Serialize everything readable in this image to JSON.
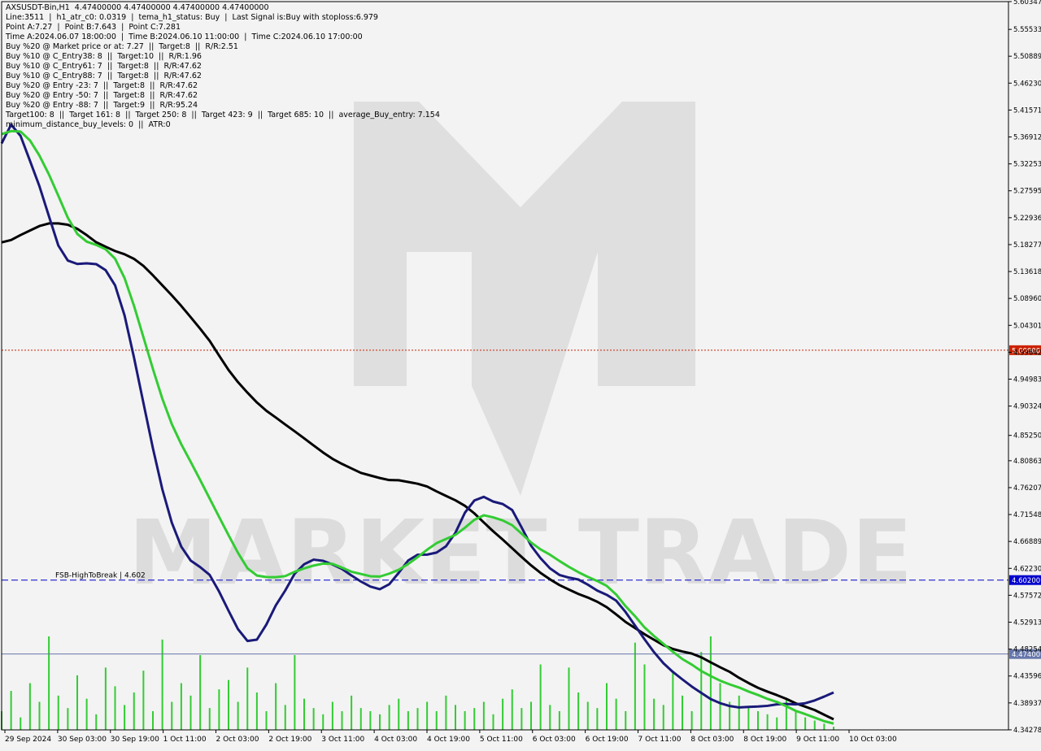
{
  "header": {
    "lines": [
      "AXSUSDT-Bin,H1  4.47400000 4.47400000 4.47400000 4.47400000",
      "Line:3511  |  h1_atr_c0: 0.0319  |  tema_h1_status: Buy  |  Last Signal is:Buy with stoploss:6.979",
      "Point A:7.27  |  Point B:7.643  |  Point C:7.281",
      "Time A:2024.06.07 18:00:00  |  Time B:2024.06.10 11:00:00  |  Time C:2024.06.10 17:00:00",
      "Buy %20 @ Market price or at: 7.27  ||  Target:8  ||  R/R:2.51",
      "Buy %10 @ C_Entry38: 8  ||  Target:10  ||  R/R:1.96",
      "Buy %10 @ C_Entry61: 7  ||  Target:8  ||  R/R:47.62",
      "Buy %10 @ C_Entry88: 7  ||  Target:8  ||  R/R:47.62",
      "Buy %20 @ Entry -23: 7  ||  Target:8  ||  R/R:47.62",
      "Buy %20 @ Entry -50: 7  ||  Target:8  ||  R/R:47.62",
      "Buy %20 @ Entry -88: 7  ||  Target:9  ||  R/R:95.24",
      "Target100: 8  ||  Target 161: 8  ||  Target 250: 8  ||  Target 423: 9  ||  Target 685: 10  ||  average_Buy_entry: 7.154",
      "minimum_distance_buy_levels: 0  ||  ATR:0"
    ]
  },
  "watermark": {
    "text": "MARKET TRADE"
  },
  "chart_data": {
    "type": "line",
    "symbol": "AXSUSDT-Bin",
    "timeframe": "H1",
    "ylim": [
      4.3427,
      5.6034
    ],
    "y_ticks": [
      "5.60347",
      "5.55533",
      "5.50889",
      "5.46230",
      "5.41571",
      "5.36912",
      "5.32253",
      "5.27595",
      "5.22936",
      "5.18277",
      "5.13618",
      "5.08960",
      "5.04301",
      "4.99642",
      "4.94983",
      "4.90324",
      "4.85250",
      "4.80863",
      "4.76207",
      "4.71548",
      "4.66889",
      "4.62230",
      "4.57572",
      "4.52913",
      "4.48254",
      "4.43596",
      "4.38937",
      "4.34278"
    ],
    "x_ticks": [
      "29 Sep 2024",
      "30 Sep 03:00",
      "30 Sep 19:00",
      "1 Oct 11:00",
      "2 Oct 03:00",
      "2 Oct 19:00",
      "3 Oct 11:00",
      "4 Oct 03:00",
      "4 Oct 19:00",
      "5 Oct 11:00",
      "6 Oct 03:00",
      "6 Oct 19:00",
      "7 Oct 11:00",
      "8 Oct 03:00",
      "8 Oct 19:00",
      "9 Oct 11:00",
      "10 Oct 03:00"
    ],
    "levels": [
      {
        "label": "5.00000",
        "value": 5.0,
        "color": "#cc2200",
        "style": "dotted"
      },
      {
        "label": "4.60200",
        "value": 4.602,
        "color": "#0000cc",
        "style": "dashed",
        "name": "FSB-HighToBreak | 4.602"
      },
      {
        "label": "4.47400",
        "value": 4.474,
        "color": "#6677aa",
        "style": "solid"
      }
    ],
    "series": [
      {
        "color": "#000000",
        "x": [
          0,
          3,
          6,
          9,
          12,
          15,
          18,
          21,
          24,
          27,
          30,
          33,
          36,
          39,
          42,
          45,
          48,
          51,
          54,
          57,
          60,
          63,
          66,
          69,
          72,
          75,
          78,
          81,
          84,
          87,
          90,
          93,
          96,
          99,
          102,
          105,
          108,
          111,
          114,
          117,
          120,
          123,
          126,
          129,
          132,
          135,
          138,
          141,
          144,
          147,
          150,
          153,
          156,
          159,
          162,
          165,
          168,
          171,
          174,
          177,
          180,
          183,
          186,
          189,
          192,
          195,
          198,
          201,
          204,
          207,
          210,
          213,
          216,
          219,
          222,
          225,
          228,
          231,
          234,
          237,
          240,
          243,
          246,
          249,
          252,
          255,
          258,
          261,
          264
        ],
        "y": [
          5.1866,
          5.1907,
          5.1993,
          5.2071,
          5.2149,
          5.2194,
          5.2194,
          5.2172,
          5.2101,
          5.1992,
          5.1869,
          5.1791,
          5.1716,
          5.1661,
          5.1581,
          5.1458,
          5.1296,
          5.1123,
          5.0949,
          5.0766,
          5.057,
          5.0371,
          5.0162,
          4.9908,
          4.9657,
          4.9447,
          4.9265,
          4.9095,
          4.8951,
          4.8834,
          4.8713,
          4.8595,
          4.8474,
          4.8351,
          4.8229,
          4.8119,
          4.8031,
          4.7953,
          4.7876,
          4.7831,
          4.7787,
          4.7751,
          4.7748,
          4.7719,
          4.7688,
          4.764,
          4.7556,
          4.7477,
          4.7401,
          4.7306,
          4.7175,
          4.7017,
          4.6864,
          4.6721,
          4.6571,
          4.642,
          4.6275,
          4.6145,
          4.6033,
          4.5934,
          4.5856,
          4.578,
          4.5718,
          4.5645,
          4.5551,
          4.5426,
          4.5295,
          4.5189,
          4.5083,
          4.4987,
          4.4893,
          4.4827,
          4.4784,
          4.4748,
          4.4683,
          4.4595,
          4.4511,
          4.4432,
          4.4328,
          4.4238,
          4.4155,
          4.4089,
          4.4029,
          4.3964,
          4.3886,
          4.3829,
          4.377,
          4.3689,
          4.361
        ]
      },
      {
        "color": "#1a1a7a",
        "x": [
          0,
          3,
          6,
          9,
          12,
          15,
          18,
          21,
          24,
          27,
          30,
          33,
          36,
          39,
          42,
          45,
          48,
          51,
          54,
          57,
          60,
          63,
          66,
          69,
          72,
          75,
          78,
          81,
          84,
          87,
          90,
          93,
          96,
          99,
          102,
          105,
          108,
          111,
          114,
          117,
          120,
          123,
          126,
          129,
          132,
          135,
          138,
          141,
          144,
          147,
          150,
          153,
          156,
          159,
          162,
          165,
          168,
          171,
          174,
          177,
          180,
          183,
          186,
          189,
          192,
          195,
          198,
          201,
          204,
          207,
          210,
          213,
          216,
          219,
          222,
          225,
          228,
          231,
          234,
          237,
          240,
          243,
          246,
          249,
          252,
          255,
          258,
          261,
          264
        ],
        "y": [
          5.358,
          5.3904,
          5.3711,
          5.3277,
          5.2838,
          5.2321,
          5.1811,
          5.1552,
          5.1493,
          5.1503,
          5.149,
          5.1385,
          5.1123,
          5.0603,
          4.9873,
          4.9085,
          4.8304,
          4.759,
          4.7014,
          4.6599,
          4.6357,
          4.6245,
          4.611,
          4.5822,
          4.549,
          4.517,
          4.4966,
          4.4989,
          4.525,
          4.5582,
          4.584,
          4.6132,
          4.6295,
          4.6374,
          4.6354,
          4.629,
          4.6213,
          4.61,
          4.5995,
          4.5908,
          4.5862,
          4.5948,
          4.6146,
          4.6359,
          4.6459,
          4.6461,
          4.6496,
          4.6605,
          4.684,
          4.7186,
          4.7398,
          4.7461,
          4.7379,
          4.7337,
          4.7233,
          4.6931,
          4.6616,
          4.6399,
          4.6223,
          4.6109,
          4.6063,
          4.603,
          4.5941,
          4.5838,
          4.5765,
          4.5664,
          4.5466,
          4.5231,
          4.4996,
          4.4773,
          4.4581,
          4.443,
          4.4301,
          4.4177,
          4.4068,
          4.396,
          4.3889,
          4.384,
          4.3815,
          4.3825,
          4.3832,
          4.3843,
          4.3868,
          4.3875,
          4.3869,
          4.3888,
          4.3937,
          4.4003,
          4.4075
        ]
      },
      {
        "color": "#33cc33",
        "x": [
          0,
          3,
          6,
          9,
          12,
          15,
          18,
          21,
          24,
          27,
          30,
          33,
          36,
          39,
          42,
          45,
          48,
          51,
          54,
          57,
          60,
          63,
          66,
          69,
          72,
          75,
          78,
          81,
          84,
          87,
          90,
          93,
          96,
          99,
          102,
          105,
          108,
          111,
          114,
          117,
          120,
          123,
          126,
          129,
          132,
          135,
          138,
          141,
          144,
          147,
          150,
          153,
          156,
          159,
          162,
          165,
          168,
          171,
          174,
          177,
          180,
          183,
          186,
          189,
          192,
          195,
          198,
          201,
          204,
          207,
          210,
          213,
          216,
          219,
          222,
          225,
          228,
          231,
          234,
          237,
          240,
          243,
          246,
          249,
          252,
          255,
          258,
          261,
          264
        ],
        "y": [
          5.3739,
          5.3793,
          5.3785,
          5.3631,
          5.3369,
          5.3043,
          5.2673,
          5.2293,
          5.2013,
          5.1879,
          5.1823,
          5.1747,
          5.1583,
          5.1249,
          5.0769,
          5.0224,
          4.9676,
          4.9159,
          4.872,
          4.8372,
          4.8066,
          4.7752,
          4.7433,
          4.7115,
          4.6798,
          4.6492,
          4.6225,
          4.6099,
          4.6072,
          4.6071,
          4.6089,
          4.6163,
          4.6223,
          4.6271,
          4.6305,
          4.63,
          4.6235,
          4.6165,
          4.6126,
          4.6087,
          4.6081,
          4.6132,
          4.6198,
          4.6298,
          4.6418,
          4.6545,
          4.6659,
          4.6731,
          4.6803,
          4.6926,
          4.7064,
          4.7142,
          4.7106,
          4.7053,
          4.697,
          4.6823,
          4.6671,
          4.6552,
          4.646,
          4.6351,
          4.6249,
          4.6157,
          4.6076,
          4.6004,
          4.592,
          4.577,
          4.5567,
          4.5394,
          4.5201,
          4.5052,
          4.4917,
          4.4778,
          4.4653,
          4.4557,
          4.4446,
          4.4358,
          4.4279,
          4.4215,
          4.416,
          4.4091,
          4.4031,
          4.3964,
          4.391,
          4.3837,
          4.3756,
          4.37,
          4.3639,
          4.3578,
          4.3536
        ]
      }
    ],
    "volume": {
      "color": "#33cc33",
      "x": [
        0,
        3,
        6,
        9,
        12,
        15,
        18,
        21,
        24,
        27,
        30,
        33,
        36,
        39,
        42,
        45,
        48,
        51,
        54,
        57,
        60,
        63,
        66,
        69,
        72,
        75,
        78,
        81,
        84,
        87,
        90,
        93,
        96,
        99,
        102,
        105,
        108,
        111,
        114,
        117,
        120,
        123,
        126,
        129,
        132,
        135,
        138,
        141,
        144,
        147,
        150,
        153,
        156,
        159,
        162,
        165,
        168,
        171,
        174,
        177,
        180,
        183,
        186,
        189,
        192,
        195,
        198,
        201,
        204,
        207,
        210,
        213,
        216,
        219,
        222,
        225,
        228,
        231,
        234,
        237,
        240,
        243,
        246,
        249,
        252,
        255,
        258,
        261,
        264
      ],
      "values": [
        12,
        25,
        8,
        30,
        18,
        60,
        22,
        14,
        35,
        20,
        10,
        40,
        28,
        16,
        24,
        38,
        12,
        58,
        18,
        30,
        22,
        48,
        14,
        26,
        32,
        18,
        40,
        24,
        12,
        30,
        16,
        48,
        20,
        14,
        10,
        18,
        12,
        22,
        14,
        12,
        10,
        16,
        20,
        12,
        14,
        18,
        12,
        22,
        16,
        12,
        14,
        18,
        10,
        20,
        26,
        14,
        18,
        42,
        16,
        12,
        40,
        24,
        18,
        14,
        30,
        20,
        12,
        56,
        42,
        20,
        16,
        38,
        22,
        12,
        50,
        60,
        30,
        18,
        22,
        14,
        12,
        10,
        8,
        20,
        12,
        8,
        6,
        4,
        2
      ]
    },
    "price_tag": {
      "value": 4.474,
      "label": "4.47400"
    }
  }
}
